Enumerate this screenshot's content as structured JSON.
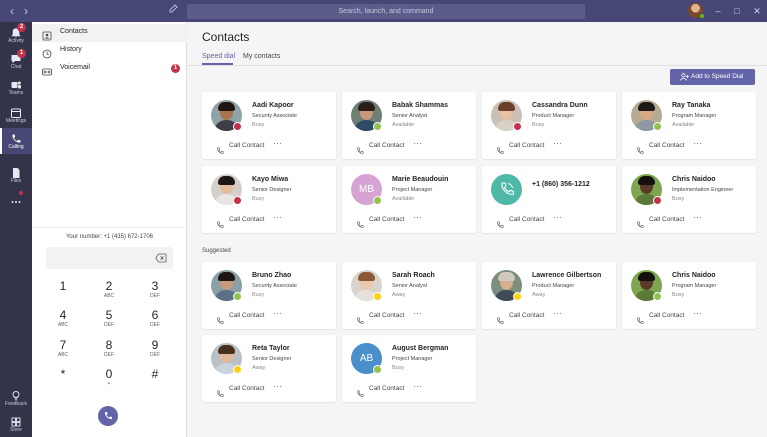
{
  "topbar": {
    "search_placeholder": "Search, launch, and command",
    "presence_color": "#6bb700",
    "icons": [
      "back-arrow-icon",
      "forward-arrow-icon",
      "compose-icon",
      "minimize-icon",
      "maximize-icon",
      "close-icon"
    ]
  },
  "rail": {
    "items": [
      {
        "label": "Activity",
        "icon": "bell-icon",
        "badge": "2",
        "active": false
      },
      {
        "label": "Chat",
        "icon": "chat-icon",
        "badge": "1",
        "active": false
      },
      {
        "label": "Teams",
        "icon": "teams-icon",
        "badge": "",
        "active": false
      },
      {
        "label": "Meetings",
        "icon": "calendar-icon",
        "badge": "",
        "active": false
      },
      {
        "label": "Calling",
        "icon": "phone-icon",
        "badge": "",
        "active": true
      },
      {
        "label": "Files",
        "icon": "file-icon",
        "badge": "",
        "active": false
      },
      {
        "label": "...",
        "icon": "more-icon",
        "badge": "",
        "active": false
      }
    ],
    "bottom": [
      {
        "label": "Feedback",
        "icon": "lightbulb-icon"
      },
      {
        "label": "Store",
        "icon": "store-icon"
      }
    ]
  },
  "left": {
    "nav": [
      {
        "label": "Contacts",
        "icon": "contacts-icon",
        "selected": true,
        "badge": ""
      },
      {
        "label": "History",
        "icon": "history-icon",
        "selected": false,
        "badge": ""
      },
      {
        "label": "Voicemail",
        "icon": "voicemail-icon",
        "selected": false,
        "badge": "1"
      }
    ],
    "your_number": "Your number: +1 (435) 672-1706",
    "keys": [
      {
        "num": "1",
        "sub": ""
      },
      {
        "num": "2",
        "sub": "ABC"
      },
      {
        "num": "3",
        "sub": "DEF"
      },
      {
        "num": "4",
        "sub": "ABC"
      },
      {
        "num": "5",
        "sub": "DEF"
      },
      {
        "num": "6",
        "sub": "DEF"
      },
      {
        "num": "7",
        "sub": "ABC"
      },
      {
        "num": "8",
        "sub": "DEF"
      },
      {
        "num": "9",
        "sub": "DEF"
      },
      {
        "num": "*",
        "sub": ""
      },
      {
        "num": "0",
        "sub": "+"
      },
      {
        "num": "#",
        "sub": ""
      }
    ]
  },
  "main": {
    "title": "Contacts",
    "tabs": [
      "Speed dial",
      "My contacts"
    ],
    "add_button": "Add to Speed Dial",
    "suggested_label": "Suggested",
    "call_label": "Call Contact",
    "more_label": "···",
    "accent": "#6264a7",
    "speed_dial": [
      {
        "name": "Aadi Kapoor",
        "title": "Security Associate",
        "status": "Busy",
        "presence": "busy",
        "avatar": "photo",
        "skin": "#a8754f",
        "hair": "#1f1611",
        "shirt": "#3d3d46",
        "bg": "#8fa3a8",
        "initials": ""
      },
      {
        "name": "Babak Shammas",
        "title": "Senior Analyst",
        "status": "Available",
        "presence": "available",
        "avatar": "photo",
        "skin": "#c9977a",
        "hair": "#2a1e17",
        "shirt": "#2e4a66",
        "bg": "#6e7f73",
        "initials": ""
      },
      {
        "name": "Cassandra Dunn",
        "title": "Product Manager",
        "status": "Busy",
        "presence": "busy",
        "avatar": "photo",
        "skin": "#e8c2a6",
        "hair": "#6b3f2a",
        "shirt": "#d8d1c8",
        "bg": "#c9c0b6",
        "initials": ""
      },
      {
        "name": "Ray Tanaka",
        "title": "Program Manager",
        "status": "Available",
        "presence": "available",
        "avatar": "photo",
        "skin": "#d6a883",
        "hair": "#1c1a18",
        "shirt": "#8d9aa6",
        "bg": "#b7aa93",
        "initials": ""
      },
      {
        "name": "Kayo Miwa",
        "title": "Senior Designer",
        "status": "Busy",
        "presence": "busy",
        "avatar": "photo",
        "skin": "#e3bc9a",
        "hair": "#1e1714",
        "shirt": "#e9e5e0",
        "bg": "#d3d0cc",
        "initials": ""
      },
      {
        "name": "Marie Beaudouin",
        "title": "Project Manager",
        "status": "Available",
        "presence": "available",
        "avatar": "initials",
        "skin": "",
        "hair": "",
        "shirt": "",
        "bg": "#d6a3d4",
        "initials": "MB"
      },
      {
        "name": "+1 (860) 356-1212",
        "title": "",
        "status": "",
        "presence": "none",
        "avatar": "phone",
        "skin": "",
        "hair": "",
        "shirt": "",
        "bg": "#4fb8a6",
        "initials": ""
      },
      {
        "name": "Chris Naidoo",
        "title": "Implementation Engineer",
        "status": "Busy",
        "presence": "busy",
        "avatar": "photo",
        "skin": "#5a3a24",
        "hair": "#15100c",
        "shirt": "#5b7a3a",
        "bg": "#7da651",
        "initials": ""
      }
    ],
    "suggested": [
      {
        "name": "Bruno Zhao",
        "title": "Security Associate",
        "status": "Busy",
        "presence": "available",
        "avatar": "photo",
        "skin": "#c69a7a",
        "hair": "#1c1612",
        "shirt": "#5c6f87",
        "bg": "#8aa0a7",
        "initials": ""
      },
      {
        "name": "Sarah Roach",
        "title": "Senior Analyst",
        "status": "Away",
        "presence": "away",
        "avatar": "photo",
        "skin": "#eac9ad",
        "hair": "#8a5a34",
        "shirt": "#e5e0d9",
        "bg": "#d9d4cd",
        "initials": ""
      },
      {
        "name": "Lawrence Gilbertson",
        "title": "Product Manager",
        "status": "Away",
        "presence": "away",
        "avatar": "photo",
        "skin": "#d9ad8f",
        "hair": "#cfc9c0",
        "shirt": "#3e4a55",
        "bg": "#7a8f7e",
        "initials": ""
      },
      {
        "name": "Chris Naidoo",
        "title": "Program Manager",
        "status": "Busy",
        "presence": "available",
        "avatar": "photo",
        "skin": "#5a3a24",
        "hair": "#15100c",
        "shirt": "#5b7a3a",
        "bg": "#7da651",
        "initials": ""
      },
      {
        "name": "Reta Taylor",
        "title": "Senior Designer",
        "status": "Away",
        "presence": "away",
        "avatar": "photo",
        "skin": "#e2b998",
        "hair": "#4a2e1c",
        "shirt": "#c8d3dc",
        "bg": "#b8c2c6",
        "initials": ""
      },
      {
        "name": "August Bergman",
        "title": "Project Manager",
        "status": "Busy",
        "presence": "available",
        "avatar": "initials",
        "skin": "",
        "hair": "",
        "shirt": "",
        "bg": "#4a8fc9",
        "initials": "AB"
      }
    ]
  }
}
